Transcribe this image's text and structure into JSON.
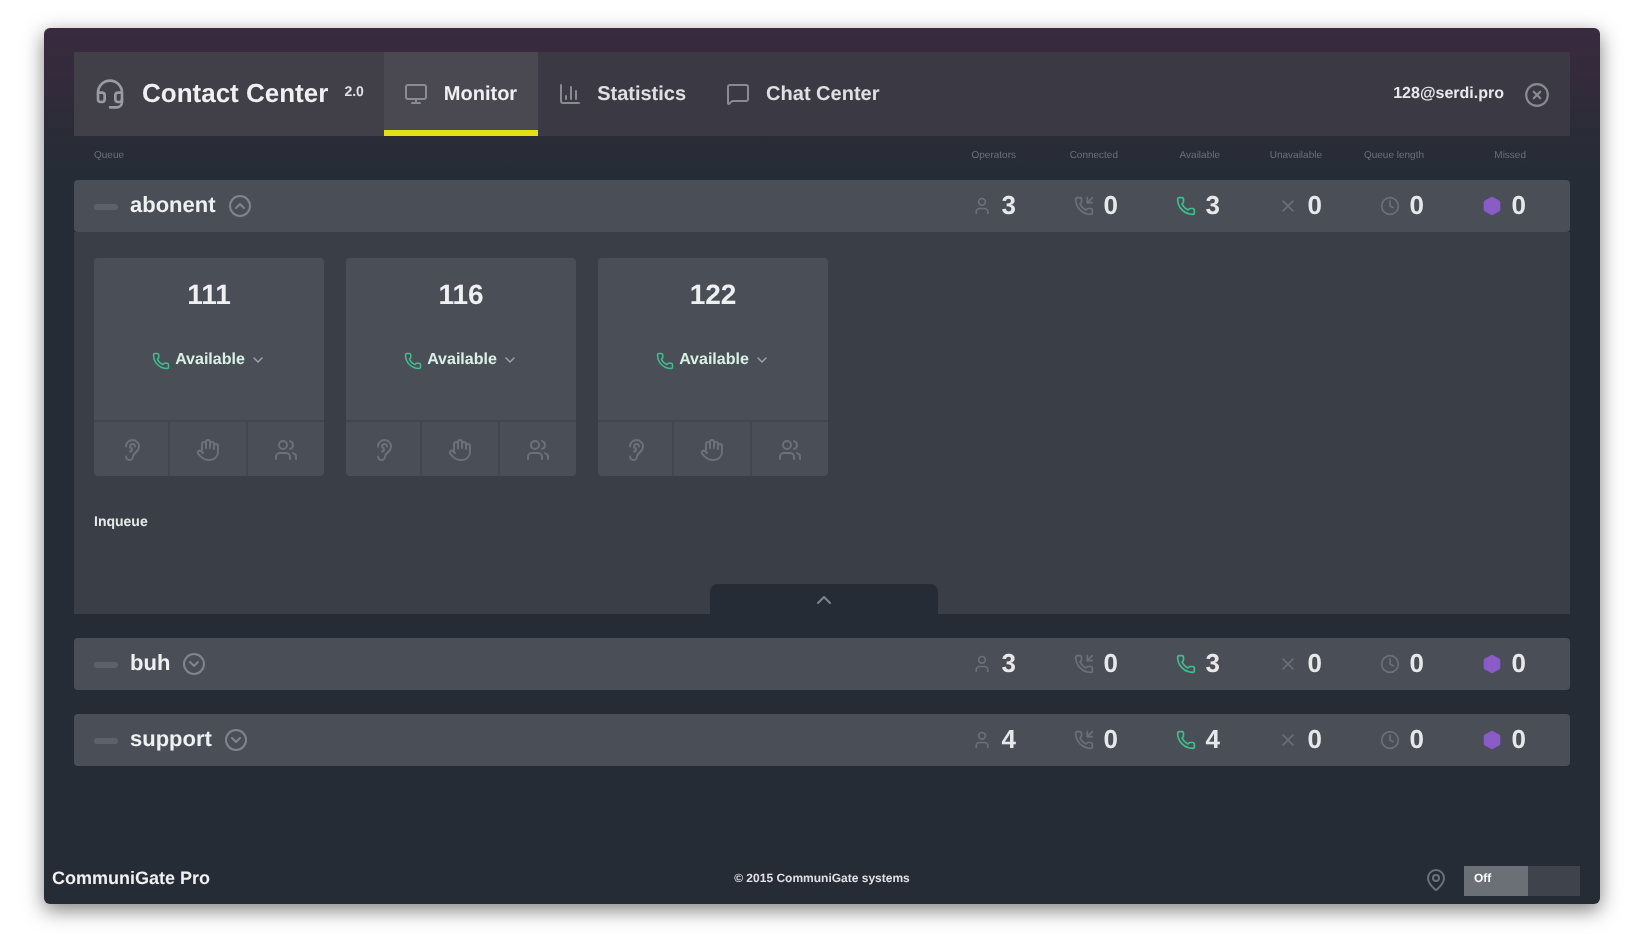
{
  "header": {
    "title": "Contact Center",
    "version": "2.0",
    "user": "128@serdi.pro",
    "tabs": [
      {
        "kind": "monitor",
        "label": "Monitor",
        "selected": true
      },
      {
        "kind": "statistics",
        "label": "Statistics",
        "selected": false
      },
      {
        "kind": "chat",
        "label": "Chat Center",
        "selected": false
      }
    ]
  },
  "columns": [
    "Queue",
    "Operators",
    "Connected",
    "Available",
    "Unavailable",
    "Queue length",
    "Missed"
  ],
  "queues": [
    {
      "name": "abonent",
      "expanded": true,
      "stats": [
        "3",
        "0",
        "3",
        "0",
        "0",
        "0"
      ],
      "operators": [
        {
          "number": "111",
          "status": "Available"
        },
        {
          "number": "116",
          "status": "Available"
        },
        {
          "number": "122",
          "status": "Available"
        }
      ],
      "section": "Inqueue"
    },
    {
      "name": "buh",
      "expanded": false,
      "stats": [
        "3",
        "0",
        "3",
        "0",
        "0",
        "0"
      ]
    },
    {
      "name": "support",
      "expanded": false,
      "stats": [
        "4",
        "0",
        "4",
        "0",
        "0",
        "0"
      ]
    }
  ],
  "footer": {
    "brand": "CommuniGate Pro",
    "copyright": "© 2015 CommuniGate systems",
    "toggle": {
      "label": "Off",
      "on": false
    }
  }
}
